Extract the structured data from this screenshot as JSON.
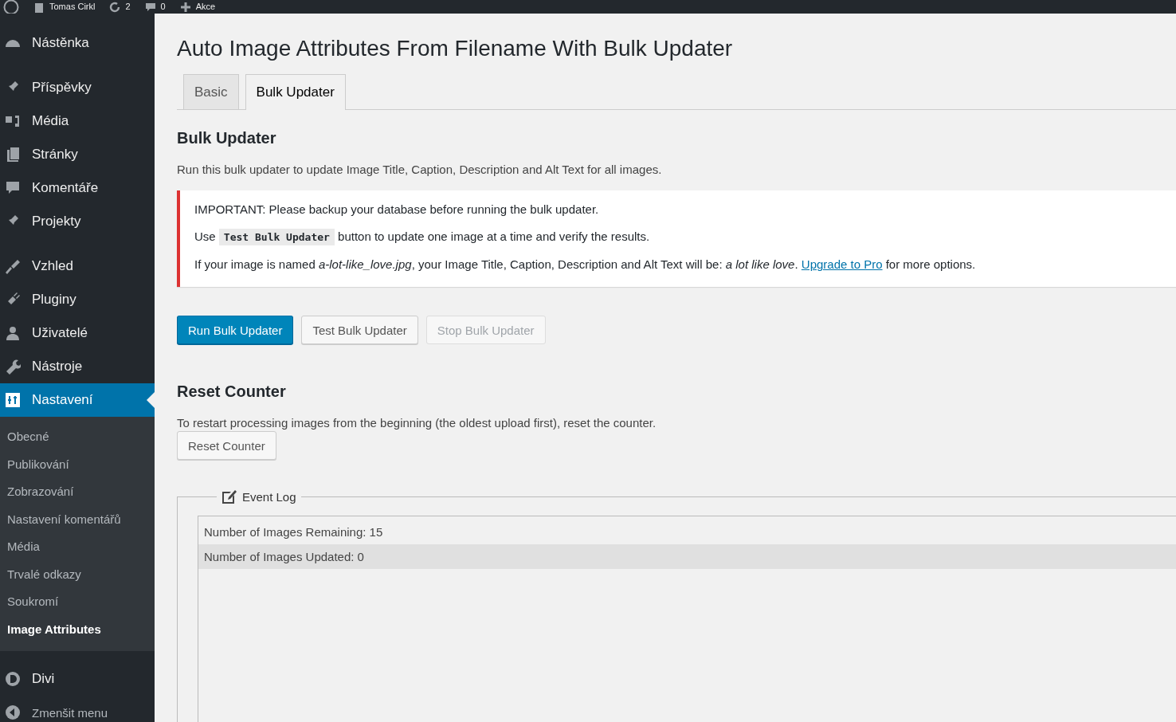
{
  "admin_bar": {
    "items": [
      {
        "label": "Tomas Cirkl"
      },
      {
        "label": "2"
      },
      {
        "label": "0"
      },
      {
        "label": "Akce"
      }
    ]
  },
  "sidebar": {
    "sections": [
      {
        "items": [
          {
            "label": "Nástěnka",
            "selected": false
          }
        ]
      },
      {
        "items": [
          {
            "label": "Příspěvky",
            "selected": false
          },
          {
            "label": "Média",
            "selected": false
          },
          {
            "label": "Stránky",
            "selected": false
          },
          {
            "label": "Komentáře",
            "selected": false
          },
          {
            "label": "Projekty",
            "selected": false
          }
        ]
      },
      {
        "items": [
          {
            "label": "Vzhled",
            "selected": false
          },
          {
            "label": "Pluginy",
            "selected": false
          },
          {
            "label": "Uživatelé",
            "selected": false
          },
          {
            "label": "Nástroje",
            "selected": false
          },
          {
            "label": "Nastavení",
            "selected": true,
            "submenu": [
              {
                "label": "Obecné",
                "selected": false
              },
              {
                "label": "Publikování",
                "selected": false
              },
              {
                "label": "Zobrazování",
                "selected": false
              },
              {
                "label": "Nastavení komentářů",
                "selected": false
              },
              {
                "label": "Média",
                "selected": false
              },
              {
                "label": "Trvalé odkazy",
                "selected": false
              },
              {
                "label": "Soukromí",
                "selected": false
              },
              {
                "label": "Image Attributes",
                "selected": true
              }
            ]
          }
        ]
      },
      {
        "items": [
          {
            "label": "Divi",
            "selected": false
          },
          {
            "label": "Zmenšit menu",
            "selected": false
          }
        ]
      }
    ]
  },
  "page": {
    "title": "Auto Image Attributes From Filename With Bulk Updater",
    "tabs": [
      {
        "label": "Basic",
        "selected": false
      },
      {
        "label": "Bulk Updater",
        "selected": true
      }
    ],
    "bulk": {
      "heading": "Bulk Updater",
      "description": "Run this bulk updater to update Image Title, Caption, Description and Alt Text for all images.",
      "notice": {
        "important": "IMPORTANT: Please backup your database before running the bulk updater.",
        "use_prefix": "Use",
        "use_code": "Test Bulk Updater",
        "use_suffix": "button to update one image at a time and verify the results.",
        "example": "If your image is named *a-lot-like_love.jpg*, your Image Title, Caption, Description and Alt Text will be: *a lot like love*.",
        "link": "Upgrade to Pro",
        "example_suffix": "for more options."
      },
      "buttons": [
        {
          "label": "Run Bulk Updater",
          "kind": "primary",
          "disabled": false
        },
        {
          "label": "Test Bulk Updater",
          "kind": "secondary",
          "disabled": false
        },
        {
          "label": "Stop Bulk Updater",
          "kind": "secondary",
          "disabled": true
        }
      ]
    },
    "reset": {
      "heading": "Reset Counter",
      "description": "To restart processing images from the beginning (the oldest upload first), reset the counter.",
      "button": "Reset Counter"
    },
    "event_log": {
      "legend": "Event Log",
      "rows": [
        {
          "text": "Number of Images Remaining: 15",
          "shaded": false
        },
        {
          "text": "Number of Images Updated: 0",
          "shaded": true
        }
      ]
    }
  }
}
